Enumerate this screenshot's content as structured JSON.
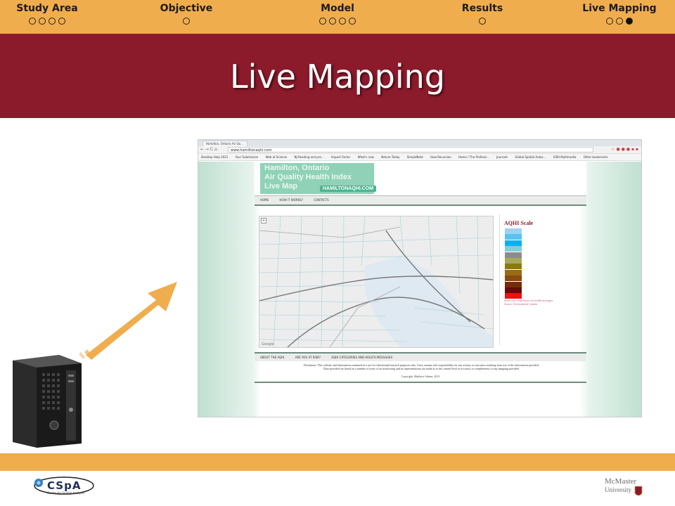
{
  "nav": {
    "sections": [
      {
        "label": "Study Area",
        "dots": 4,
        "active_dot": -1
      },
      {
        "label": "Objective",
        "dots": 1,
        "active_dot": -1
      },
      {
        "label": "Model",
        "dots": 4,
        "active_dot": -1
      },
      {
        "label": "Results",
        "dots": 1,
        "active_dot": -1
      },
      {
        "label": "Live Mapping",
        "dots": 3,
        "active_dot": 2
      }
    ]
  },
  "slide": {
    "title": "Live Mapping"
  },
  "browser": {
    "tab_title": "Hamilton, Ontario Air Qu...",
    "url": "www.hamiltonaqhi.com",
    "nav_glyphs": "←  →  C  ⌂",
    "extension_glyphs": "☆ ● ● ● ▪ ▪",
    "bookmarks": [
      "Desktop Help 2021",
      "Your Submission",
      "Web of Science",
      "NJ Reading and pre...",
      "Impact Factor",
      "What's new",
      "Nature Today",
      "SimpleNote",
      "How Recursion",
      "Home / The Professi...",
      "Journals",
      "Global Spatial Autoc...",
      "ESRI Multimedia",
      "Other bookmarks"
    ]
  },
  "website": {
    "banner": {
      "line1": "Hamilton, Ontario",
      "line2": "Air Quality Health Index",
      "line3": "Live Map",
      "url_badge": "HAMILTONAQHI.COM"
    },
    "nav_items": [
      "HOME",
      "HOW IT WORKS?",
      "CONTACTS"
    ],
    "map_credit": "Google",
    "legend": {
      "title": "AQHI Scale",
      "colors": [
        "#9fd1f3",
        "#58c2f1",
        "#00b3f0",
        "#7fcfd8",
        "#8c8c8c",
        "#a9a95a",
        "#8a7a10",
        "#9a6a14",
        "#8a4a10",
        "#7a2a0a",
        "#6a0a0a",
        "#ee1111"
      ],
      "note_line1": "Move over scale boxes for health messages",
      "note_line2": "Source: Environment Canada"
    },
    "footer_nav": [
      "ABOUT THE AQHI",
      "ARE YOU AT RISK?",
      "AQHI CATEGORIES AND HEALTH MESSAGES"
    ],
    "disclaimer_line1": "Disclaimer: This website and information contained in it are for educational/research purposes only. Users assume sole responsibility for any actions or outcomes resulting from use of the information provided.",
    "disclaimer_line2": "Data provided are based on a number of years of air monitoring and no representations are made as to the current level of accuracy or completeness of any mapping provided.",
    "copyright": "Copyright: Matthew Adams, 2013"
  },
  "logos": {
    "left": "CSpA",
    "left_sub": "Centre for Spatial Analysis",
    "right_line1": "McMaster",
    "right_line2": "University"
  },
  "colors": {
    "nav_orange": "#f0ad4e",
    "title_maroon": "#8b1a2b",
    "arrow_orange": "#f0ad4e"
  }
}
